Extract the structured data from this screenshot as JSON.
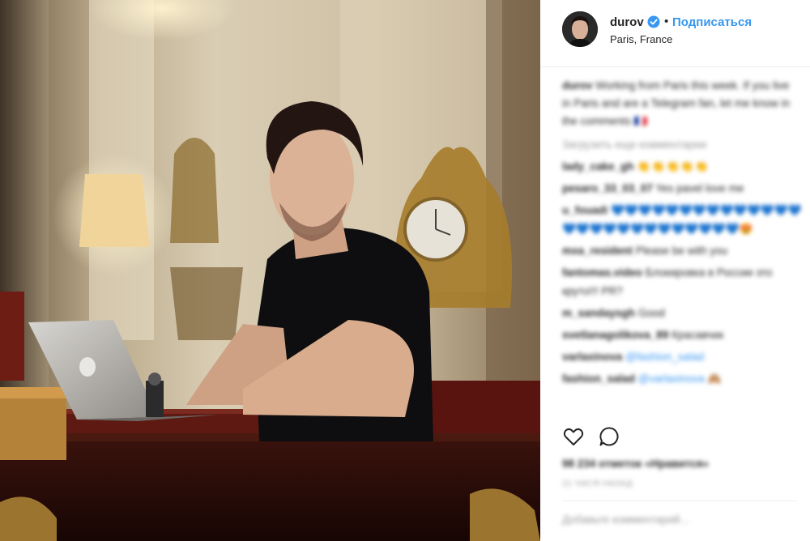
{
  "post": {
    "username": "durov",
    "follow_label": "Подписаться",
    "separator": "•",
    "location": "Paris, France"
  },
  "caption": {
    "user": "durov",
    "text": "Working from Paris this week. If you live in Paris and are a Telegram fan, let me know in the comments 🇫🇷"
  },
  "load_more": "Загрузить еще комментарии",
  "comments": [
    {
      "user": "lady_cake_gh",
      "text": "👏👏👏👏👏"
    },
    {
      "user": "pesaro_33_03_07",
      "text": "Yes pavel love me"
    },
    {
      "user": "u_fouadi",
      "text": "💙💙💙💙💙💙💙💙💙💙💙💙💙💙💙💙💙💙💙💙💙💙💙💙💙💙💙😍"
    },
    {
      "user": "mxa_resident",
      "text": "Please be with you"
    },
    {
      "user": "fantomas.video",
      "text": "Блокировка в России это круто!!! PR?"
    },
    {
      "user": "m_sandaysgh",
      "text": "Good"
    },
    {
      "user": "svetlanagolikova_89",
      "text": "Красавчик"
    },
    {
      "user": "varlaxinova",
      "text": "@fashion_salad"
    },
    {
      "user": "fashion_salad",
      "text": "@varlaxinova 🙈"
    }
  ],
  "likes": "98 234 отметок «Нравится»",
  "date": "21 ЧАСЯ НАЗАД",
  "add_comment_placeholder": "Добавьте комментарий...",
  "icons": {
    "like": "heart-icon",
    "comment": "comment-icon",
    "verified": "verified-badge-icon"
  },
  "colors": {
    "link": "#3897f0",
    "text": "#262626",
    "muted": "#999999",
    "divider": "#efefef"
  }
}
